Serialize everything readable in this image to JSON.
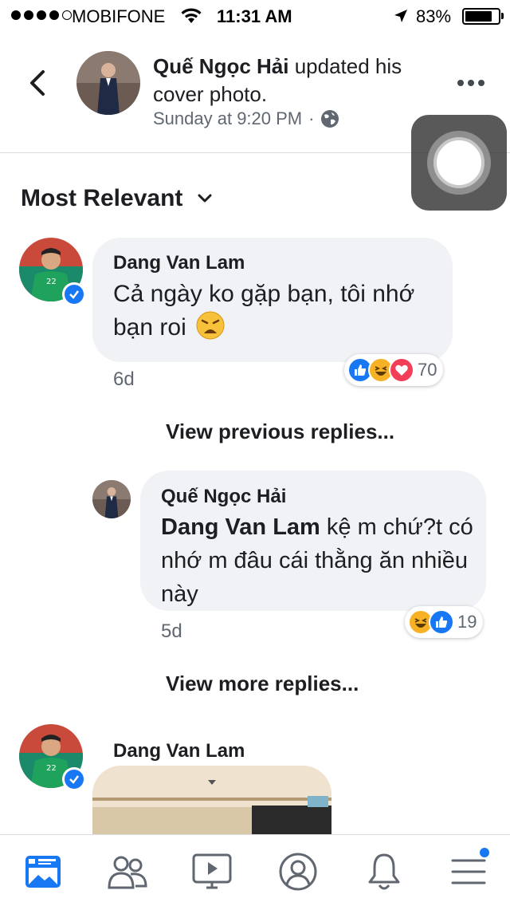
{
  "status_bar": {
    "carrier": "MOBIFONE",
    "time": "11:31 AM",
    "battery": "83%",
    "battery_level": 0.83
  },
  "header": {
    "author": "Quế Ngọc Hải",
    "action": " updated his cover photo.",
    "timestamp": "Sunday at 9:20 PM",
    "separator": "·",
    "privacy_icon": "globe-icon"
  },
  "sort": {
    "label": "Most Relevant"
  },
  "comments": [
    {
      "author": "Dang Van Lam",
      "text": "Cả ngày ko gặp bạn, tôi nhớ bạn roi",
      "emoji": "weary-face",
      "time": "6d",
      "reactions": [
        "like",
        "haha",
        "love"
      ],
      "reaction_count": "70",
      "verified": true
    },
    {
      "author": "Quế Ngọc Hải",
      "mention": "Dang Van Lam",
      "text": " kệ m chứ?t có nhớ m đâu cái thằng ăn nhiều này",
      "time": "5d",
      "reactions": [
        "haha",
        "like"
      ],
      "reaction_count": "19",
      "verified": false
    },
    {
      "author": "Dang Van Lam",
      "verified": true,
      "attachment": "photo"
    }
  ],
  "links": {
    "previous_replies": "View previous replies...",
    "more_replies": "View more replies..."
  },
  "tabbar": {
    "items": [
      "news-feed-icon",
      "friends-icon",
      "watch-icon",
      "profile-icon",
      "notifications-icon",
      "menu-icon"
    ],
    "active": "news-feed-icon",
    "accent": "#1877f2"
  },
  "colors": {
    "accent": "#1877f2",
    "bubble": "#f0f2f5",
    "secondary_text": "#606770",
    "love": "#f33e58",
    "haha": "#f7b125"
  }
}
